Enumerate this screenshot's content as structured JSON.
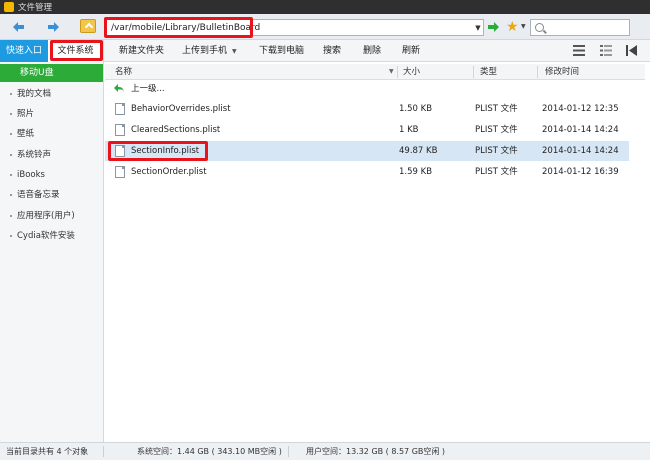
{
  "app": {
    "title": "文件管理",
    "accent": "#1d9ae0",
    "usb_color": "#2cab39",
    "highlight_color": "#e8141c"
  },
  "navbar": {
    "path": "/var/mobile/Library/BulletinBoard",
    "search_placeholder": "",
    "icons": [
      "back-arrow-icon",
      "forward-arrow-icon",
      "folder-up-icon",
      "go-arrow-icon",
      "star-icon",
      "search-icon"
    ]
  },
  "toolbar": {
    "tab_quick": "快速入口",
    "tab_fs": "文件系统",
    "new_folder": "新建文件夹",
    "upload": "上传到手机",
    "download": "下载到电脑",
    "search": "搜索",
    "delete": "删除",
    "refresh": "刷新"
  },
  "sidebar": {
    "usb": "移动U盘",
    "items": [
      "我的文档",
      "照片",
      "壁纸",
      "系统铃声",
      "iBooks",
      "语音备忘录",
      "应用程序(用户)",
      "Cydia软件安装"
    ]
  },
  "list": {
    "headers": {
      "name": "名称",
      "size": "大小",
      "type": "类型",
      "modified": "修改时间"
    },
    "up_label": "上一级...",
    "rows": [
      {
        "name": "BehaviorOverrides.plist",
        "size": "1.50 KB",
        "type": "PLIST 文件",
        "modified": "2014-01-12 12:35"
      },
      {
        "name": "ClearedSections.plist",
        "size": "1 KB",
        "type": "PLIST 文件",
        "modified": "2014-01-14 14:24"
      },
      {
        "name": "SectionInfo.plist",
        "size": "49.87 KB",
        "type": "PLIST 文件",
        "modified": "2014-01-14 14:24"
      },
      {
        "name": "SectionOrder.plist",
        "size": "1.59 KB",
        "type": "PLIST 文件",
        "modified": "2014-01-12 16:39"
      }
    ]
  },
  "status": {
    "count": "当前目录共有 4 个对象",
    "system": "系统空间：1.44 GB ( 343.10 MB空闲 )",
    "user": "用户空间：13.32 GB ( 8.57 GB空闲 )"
  }
}
